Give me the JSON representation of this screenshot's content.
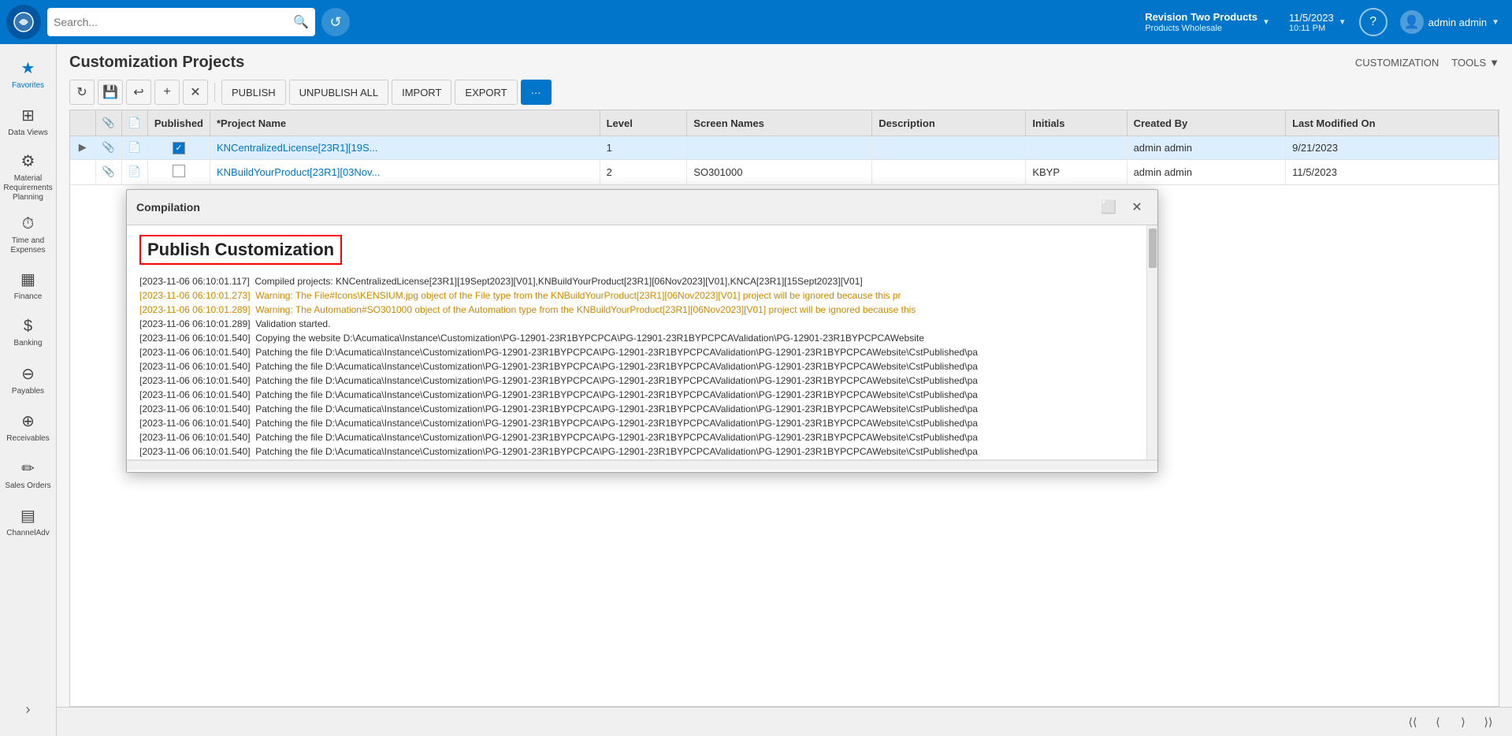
{
  "topNav": {
    "searchPlaceholder": "Search...",
    "companyName": "Revision Two Products",
    "companySub": "Products Wholesale",
    "datetime": "11/5/2023\n10:11 PM",
    "dateValue": "11/5/2023",
    "timeValue": "10:11 PM",
    "userName": "admin admin"
  },
  "pageHeader": {
    "title": "Customization Projects",
    "links": [
      "CUSTOMIZATION",
      "TOOLS"
    ]
  },
  "toolbar": {
    "buttons": [
      "refresh",
      "save",
      "undo",
      "add",
      "delete"
    ],
    "textButtons": [
      "PUBLISH",
      "UNPUBLISH ALL",
      "IMPORT",
      "EXPORT",
      "more"
    ]
  },
  "table": {
    "columns": [
      "",
      "",
      "",
      "Published",
      "*Project Name",
      "Level",
      "Screen Names",
      "Description",
      "Initials",
      "Created By",
      "Last Modified On"
    ],
    "rows": [
      {
        "hasExpander": true,
        "attachIcon": true,
        "fileIcon": true,
        "checkboxPublished": true,
        "checkboxRow": true,
        "projectName": "KNCentralizedLicense[23R1][19S...",
        "projectLink": true,
        "level": "1",
        "screenNames": "",
        "description": "",
        "initials": "",
        "createdBy": "admin admin",
        "lastModified": "9/21/2023",
        "selected": true
      },
      {
        "hasExpander": false,
        "attachIcon": true,
        "fileIcon": true,
        "checkboxPublished": false,
        "checkboxRow": false,
        "projectName": "KNBuildYourProduct[23R1][03Nov...",
        "projectLink": true,
        "level": "2",
        "screenNames": "SO301000",
        "description": "",
        "initials": "KBYP",
        "createdBy": "admin admin",
        "lastModified": "11/5/2023",
        "selected": false
      }
    ]
  },
  "modal": {
    "title": "Compilation",
    "publishTitle": "Publish Customization",
    "logs": [
      {
        "type": "normal",
        "text": "[2023-11-06 06:10:01.117]  Compiled projects: KNCentralizedLicense[23R1][19Sept2023][V01],KNBuildYourProduct[23R1][06Nov2023][V01],KNCA[23R1][15Sept2023][V01]"
      },
      {
        "type": "warning",
        "text": "[2023-11-06 06:10:01.273]  Warning: The File#Icons\\KENSIUM.jpg object of the File type from the KNBuildYourProduct[23R1][06Nov2023][V01] project will be ignored because this pr"
      },
      {
        "type": "warning",
        "text": "[2023-11-06 06:10:01.289]  Warning: The Automation#SO301000 object of the Automation type from the KNBuildYourProduct[23R1][06Nov2023][V01] project will be ignored because this"
      },
      {
        "type": "normal",
        "text": "[2023-11-06 06:10:01.289]  Validation started."
      },
      {
        "type": "normal",
        "text": "[2023-11-06 06:10:01.540]  Copying the website D:\\Acumatica\\Instance\\Customization\\PG-12901-23R1BYPCPCA\\PG-12901-23R1BYPCPCAValidation\\PG-12901-23R1BYPCPCAWebsite"
      },
      {
        "type": "normal",
        "text": "[2023-11-06 06:10:01.540]  Patching the file D:\\Acumatica\\Instance\\Customization\\PG-12901-23R1BYPCPCA\\PG-12901-23R1BYPCPCAValidation\\PG-12901-23R1BYPCPCAWebsite\\CstPublished\\pa"
      },
      {
        "type": "normal",
        "text": "[2023-11-06 06:10:01.540]  Patching the file D:\\Acumatica\\Instance\\Customization\\PG-12901-23R1BYPCPCA\\PG-12901-23R1BYPCPCAValidation\\PG-12901-23R1BYPCPCAWebsite\\CstPublished\\pa"
      },
      {
        "type": "normal",
        "text": "[2023-11-06 06:10:01.540]  Patching the file D:\\Acumatica\\Instance\\Customization\\PG-12901-23R1BYPCPCA\\PG-12901-23R1BYPCPCAValidation\\PG-12901-23R1BYPCPCAWebsite\\CstPublished\\pa"
      },
      {
        "type": "normal",
        "text": "[2023-11-06 06:10:01.540]  Patching the file D:\\Acumatica\\Instance\\Customization\\PG-12901-23R1BYPCPCA\\PG-12901-23R1BYPCPCAValidation\\PG-12901-23R1BYPCPCAWebsite\\CstPublished\\pa"
      },
      {
        "type": "normal",
        "text": "[2023-11-06 06:10:01.540]  Patching the file D:\\Acumatica\\Instance\\Customization\\PG-12901-23R1BYPCPCA\\PG-12901-23R1BYPCPCAValidation\\PG-12901-23R1BYPCPCAWebsite\\CstPublished\\pa"
      },
      {
        "type": "normal",
        "text": "[2023-11-06 06:10:01.540]  Patching the file D:\\Acumatica\\Instance\\Customization\\PG-12901-23R1BYPCPCA\\PG-12901-23R1BYPCPCAValidation\\PG-12901-23R1BYPCPCAWebsite\\CstPublished\\pa"
      },
      {
        "type": "normal",
        "text": "[2023-11-06 06:10:01.540]  Patching the file D:\\Acumatica\\Instance\\Customization\\PG-12901-23R1BYPCPCA\\PG-12901-23R1BYPCPCAValidation\\PG-12901-23R1BYPCPCAWebsite\\CstPublished\\pa"
      },
      {
        "type": "normal",
        "text": "[2023-11-06 06:10:01.540]  Patching the file D:\\Acumatica\\Instance\\Customization\\PG-12901-23R1BYPCPCA\\PG-12901-23R1BYPCPCAValidation\\PG-12901-23R1BYPCPCAWebsite\\CstPublished\\pa"
      }
    ]
  },
  "sidebar": {
    "items": [
      {
        "label": "Favorites",
        "icon": "★",
        "active": true
      },
      {
        "label": "Data Views",
        "icon": "⊞",
        "active": false
      },
      {
        "label": "Material Requirements Planning",
        "icon": "⚙",
        "active": false
      },
      {
        "label": "Time and Expenses",
        "icon": "⏱",
        "active": false
      },
      {
        "label": "Finance",
        "icon": "▦",
        "active": false
      },
      {
        "label": "Banking",
        "icon": "$",
        "active": false
      },
      {
        "label": "Payables",
        "icon": "⊖",
        "active": false
      },
      {
        "label": "Receivables",
        "icon": "⊕",
        "active": false
      },
      {
        "label": "Sales Orders",
        "icon": "✏",
        "active": false
      },
      {
        "label": "ChannelAdv",
        "icon": "▤",
        "active": false
      }
    ]
  },
  "pagination": {
    "first": "⟨⟨",
    "prev": "⟨",
    "next": "⟩",
    "last": "⟩⟩"
  }
}
